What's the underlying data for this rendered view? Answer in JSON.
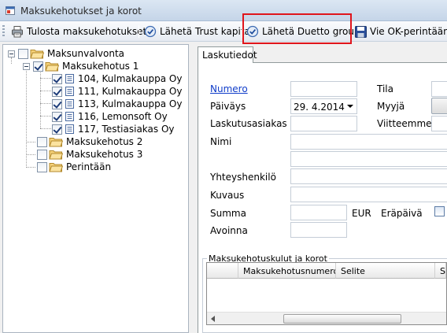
{
  "window": {
    "title": "Maksukehotukset ja korot",
    "app_icon": "window-app-icon"
  },
  "toolbar": {
    "print_label": "Tulosta maksukehotukset",
    "trust_label": "Lähetä Trust kapital",
    "duetto_label": "Lähetä Duetto group",
    "ok_label": "Vie OK-perintään",
    "highlight_color": "#e0151c"
  },
  "tree": {
    "root": "Maksunvalvonta",
    "group1": "Maksukehotus 1",
    "items": [
      "104, Kulmakauppa Oy",
      "111, Kulmakauppa Oy",
      "113, Kulmakauppa Oy",
      "116, Lemonsoft Oy",
      "117, Testiasiakas Oy"
    ],
    "group2": "Maksukehotus 2",
    "group3": "Maksukehotus 3",
    "collection": "Perintään"
  },
  "tabs": {
    "active": "Laskutiedot"
  },
  "form": {
    "numero": "Numero",
    "tila": "Tila",
    "paivays": "Päiväys",
    "paivays_value": "29.  4.2014",
    "myyja": "Myyjä",
    "laskutusasiakas": "Laskutusasiakas",
    "viitteemme": "Viitteemme",
    "nimi": "Nimi",
    "yhteyshenkilo": "Yhteyshenkilö",
    "kuvaus": "Kuvaus",
    "summa": "Summa",
    "currency": "EUR",
    "erapaiva": "Eräpäivä",
    "avoinna": "Avoinna"
  },
  "fees": {
    "group_title": "Maksukehotuskulut ja korot",
    "columns": [
      "Maksukehotusnumero",
      "Selite",
      "S"
    ]
  }
}
